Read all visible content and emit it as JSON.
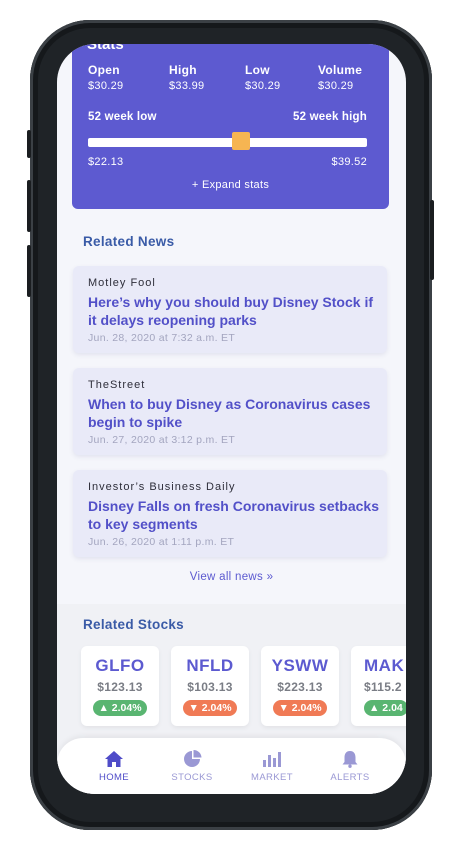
{
  "stats": {
    "title": "Stats",
    "items": [
      {
        "label": "Open",
        "value": "$30.29"
      },
      {
        "label": "High",
        "value": "$33.99"
      },
      {
        "label": "Low",
        "value": "$30.29"
      },
      {
        "label": "Volume",
        "value": "$30.29"
      }
    ],
    "week_low_label": "52 week low",
    "week_high_label": "52 week high",
    "week_low_value": "$22.13",
    "week_high_value": "$39.52",
    "range_position": 0.55,
    "expand_label": "+ Expand stats"
  },
  "news": {
    "title": "Related News",
    "items": [
      {
        "source": "Motley Fool",
        "headline": "Here’s why you should buy Disney Stock if it delays reopening parks",
        "date": "Jun. 28, 2020 at 7:32 a.m. ET"
      },
      {
        "source": "TheStreet",
        "headline": "When to buy Disney as Coronavirus cases begin to spike",
        "date": "Jun. 27, 2020 at 3:12 p.m. ET"
      },
      {
        "source": "Investor’s Business Daily",
        "headline": "Disney Falls on fresh Coronavirus setbacks to key segments",
        "date": "Jun. 26, 2020 at 1:11 p.m. ET"
      }
    ],
    "view_all_label": "View all news  »"
  },
  "stocks": {
    "title": "Related Stocks",
    "items": [
      {
        "symbol": "GLFO",
        "price": "$123.13",
        "change": "▲ 2.04%",
        "direction": "up"
      },
      {
        "symbol": "NFLD",
        "price": "$103.13",
        "change": "▼ 2.04%",
        "direction": "down"
      },
      {
        "symbol": "YSWW",
        "price": "$223.13",
        "change": "▼ 2.04%",
        "direction": "down"
      },
      {
        "symbol": "MAK",
        "price": "$115.2",
        "change": "▲ 2.04",
        "direction": "up"
      }
    ]
  },
  "tabs": [
    {
      "label": "HOME",
      "icon": "home-icon",
      "active": true
    },
    {
      "label": "STOCKS",
      "icon": "pie-chart-icon",
      "active": false
    },
    {
      "label": "MARKET",
      "icon": "bar-chart-icon",
      "active": false
    },
    {
      "label": "ALERTS",
      "icon": "bell-icon",
      "active": false
    }
  ],
  "colors": {
    "accent": "#5d5ad0",
    "section_title": "#3a5ba7",
    "range_thumb": "#f6b552",
    "badge_up": "#59b571",
    "badge_down": "#f07a55",
    "tab_active": "#4f4cc8",
    "tab_inactive": "#9a98d4"
  }
}
